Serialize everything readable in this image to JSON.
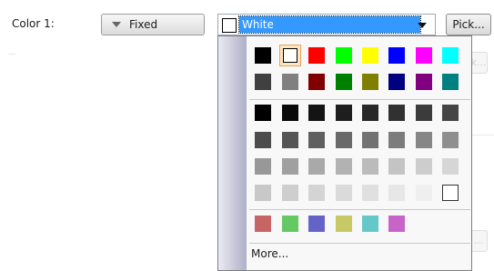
{
  "form": {
    "color_label": "Color 1:",
    "mode_button": "Fixed",
    "selected_color": "White",
    "pick_button": "Pick..."
  },
  "popup": {
    "more_label": "More...",
    "highlighted_index": 1,
    "colors": {
      "standard": [
        [
          "#000000",
          "#ffffff",
          "#ff0000",
          "#00ff00",
          "#ffff00",
          "#0000ff",
          "#ff00ff",
          "#00ffff"
        ],
        [
          "#404040",
          "#808080",
          "#800000",
          "#008000",
          "#808000",
          "#000080",
          "#800080",
          "#008080"
        ]
      ],
      "grays": [
        [
          "#000000",
          "#0a0a0a",
          "#141414",
          "#1e1e1e",
          "#282828",
          "#313131",
          "#3b3b3b",
          "#454545"
        ],
        [
          "#4c4c4c",
          "#555555",
          "#5f5f5f",
          "#696969",
          "#727272",
          "#7c7c7c",
          "#868686",
          "#8f8f8f"
        ],
        [
          "#989898",
          "#a0a0a0",
          "#a9a9a9",
          "#b2b2b2",
          "#bbbbbb",
          "#c4c4c4",
          "#cdcdcd",
          "#d6d6d6"
        ],
        [
          "#c8c8c8",
          "#cecece",
          "#d4d4d4",
          "#dadada",
          "#e0e0e0",
          "#e7e7e7",
          "#efefef",
          "#ffffff"
        ]
      ],
      "custom": [
        "#c86464",
        "#64c864",
        "#6464c8",
        "#c8c864",
        "#64c8c8",
        "#c864c8"
      ]
    }
  }
}
